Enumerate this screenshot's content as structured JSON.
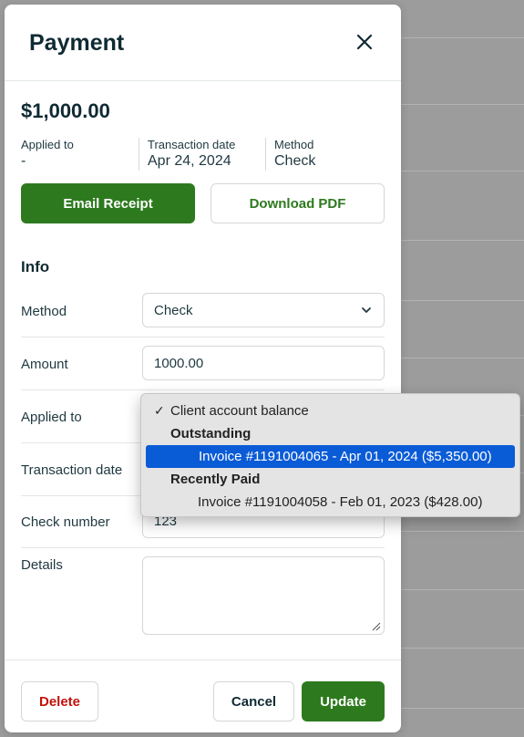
{
  "modal": {
    "title": "Payment"
  },
  "summary": {
    "amount": "$1,000.00",
    "applied_to_label": "Applied to",
    "applied_to_value": "-",
    "transaction_date_label": "Transaction date",
    "transaction_date_value": "Apr 24, 2024",
    "method_label": "Method",
    "method_value": "Check"
  },
  "actions": {
    "email_receipt": "Email Receipt",
    "download_pdf": "Download PDF"
  },
  "info": {
    "title": "Info",
    "method_label": "Method",
    "method_value": "Check",
    "amount_label": "Amount",
    "amount_value": "1000.00",
    "applied_to_label": "Applied to",
    "transaction_date_label": "Transaction date",
    "check_number_label": "Check number",
    "check_number_value": "123",
    "details_label": "Details",
    "details_value": ""
  },
  "dropdown": {
    "option_client_balance": "Client account balance",
    "group_outstanding": "Outstanding",
    "option_invoice_outstanding": "Invoice #1191004065 - Apr 01, 2024 ($5,350.00)",
    "group_recently_paid": "Recently Paid",
    "option_invoice_paid": "Invoice #1191004058 - Feb 01, 2023 ($428.00)"
  },
  "footer": {
    "delete": "Delete",
    "cancel": "Cancel",
    "update": "Update"
  },
  "colors": {
    "brand_green": "#2d7a1e",
    "danger_red": "#c0120c",
    "selection_blue": "#0a5bd6"
  }
}
